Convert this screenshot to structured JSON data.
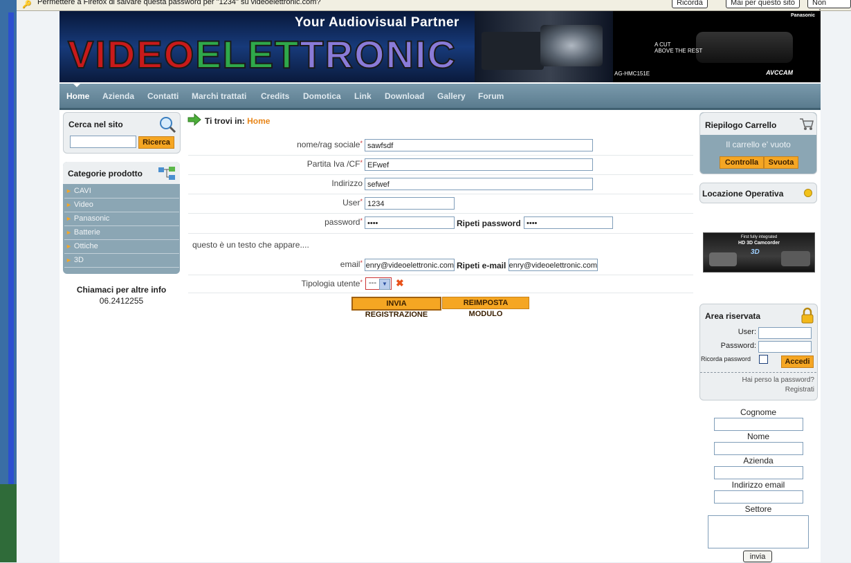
{
  "browser": {
    "notification": "Permettere a Firefox di salvare questa password per \"1234\" su videoelettronic.com?",
    "remember_button": "Ricorda",
    "never_button": "Mai per questo sito",
    "not_now_button": "Non adesso"
  },
  "banner": {
    "tagline": "Your Audiovisual Partner",
    "logo_text": "VIDEOELETTRONIC",
    "ad_line1": "A CUT",
    "ad_line2": "ABOVE THE REST",
    "ad_model": "AG-HMC151E",
    "ad_brand": "Panasonic",
    "ad_product": "AVCCAM"
  },
  "menu": {
    "items": [
      "Home",
      "Azienda",
      "Contatti",
      "Marchi trattati",
      "Credits",
      "Domotica",
      "Link",
      "Download",
      "Gallery",
      "Forum"
    ]
  },
  "search": {
    "title": "Cerca nel sito",
    "input_value": "",
    "button": "Ricerca"
  },
  "categories": {
    "title": "Categorie prodotto",
    "items": [
      "CAVI",
      "Video",
      "Panasonic",
      "Batterie",
      "Ottiche",
      "3D"
    ]
  },
  "contact": {
    "line1": "Chiamaci per altre info",
    "phone": "06.2412255"
  },
  "breadcrumb": {
    "prefix": "Ti trovi in:",
    "current": "Home"
  },
  "form": {
    "nome_label": "nome/rag sociale",
    "nome_value": "sawfsdf",
    "piva_label": "Partita Iva /CF",
    "piva_value": "EFwef",
    "indirizzo_label": "Indirizzo",
    "indirizzo_value": "sefwef",
    "user_label": "User",
    "user_value": "1234",
    "password_label": "password",
    "password_value": "••••",
    "ripeti_password_label": "Ripeti password",
    "ripeti_password_value": "••••",
    "note_text": "questo è un testo che appare....",
    "email_label": "email",
    "email_value": "enry@videoelettronic.com",
    "ripeti_email_label": "Ripeti e-mail",
    "ripeti_email_value": "enry@videoelettronic.com",
    "tipologia_label": "Tipologia utente",
    "tipologia_value": "---",
    "required_mark": "*",
    "submit_button": "INVIA REGISTRAZIONE",
    "reset_button": "REIMPOSTA MODULO"
  },
  "cart": {
    "title": "Riepilogo Carrello",
    "empty_text": "Il carrello e' vuoto",
    "check_button": "Controlla",
    "empty_button": "Svuota"
  },
  "location": {
    "title": "Locazione Operativa"
  },
  "ad_box": {
    "line1": "First fully integrated",
    "line2": "HD 3D Camcorder",
    "line3": "3D"
  },
  "reserved": {
    "title": "Area riservata",
    "user_label": "User:",
    "password_label": "Password:",
    "remember_label": "Ricorda password",
    "login_button": "Accedi",
    "lost_password": "Hai perso la password?",
    "register": "Registrati"
  },
  "newsletter": {
    "cognome_label": "Cognome",
    "nome_label": "Nome",
    "azienda_label": "Azienda",
    "email_label": "Indirizzo email",
    "settore_label": "Settore",
    "submit_button": "invia"
  },
  "colors": {
    "menu_bg": "#5a7b8e",
    "accent_orange": "#f5a623",
    "link_orange": "#e8861a"
  }
}
